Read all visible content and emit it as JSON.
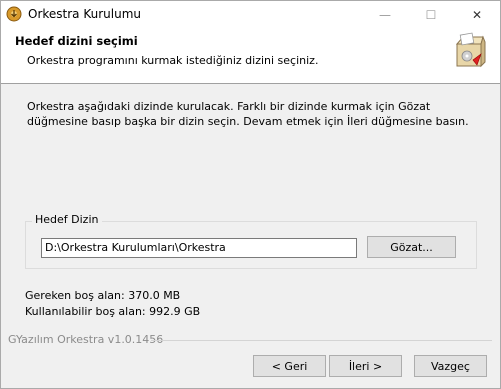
{
  "window": {
    "title": "Orkestra Kurulumu",
    "minimize_symbol": "—",
    "maximize_symbol": "☐",
    "close_symbol": "✕"
  },
  "header": {
    "title": "Hedef dizini seçimi",
    "subtitle": "Orkestra programını kurmak istediğiniz dizini seçiniz."
  },
  "intro_text": "Orkestra aşağıdaki dizinde kurulacak. Farklı bir dizinde kurmak için Gözat düğmesine basıp başka bir dizin seçin. Devam etmek için İleri düğmesine basın.",
  "destination": {
    "group_label": "Hedef Dizin",
    "path_value": "D:\\Orkestra Kurulumları\\Orkestra",
    "browse_label": "Gözat..."
  },
  "space": {
    "required": "Gereken boş alan: 370.0 MB",
    "available": "Kullanılabilir boş alan: 992.9 GB"
  },
  "branding": "GYazılım Orkestra v1.0.1456",
  "buttons": {
    "back": "< Geri",
    "next": "İleri >",
    "cancel": "Vazgeç"
  },
  "icons": {
    "app": "installer-app-icon",
    "header": "installer-box-icon"
  }
}
